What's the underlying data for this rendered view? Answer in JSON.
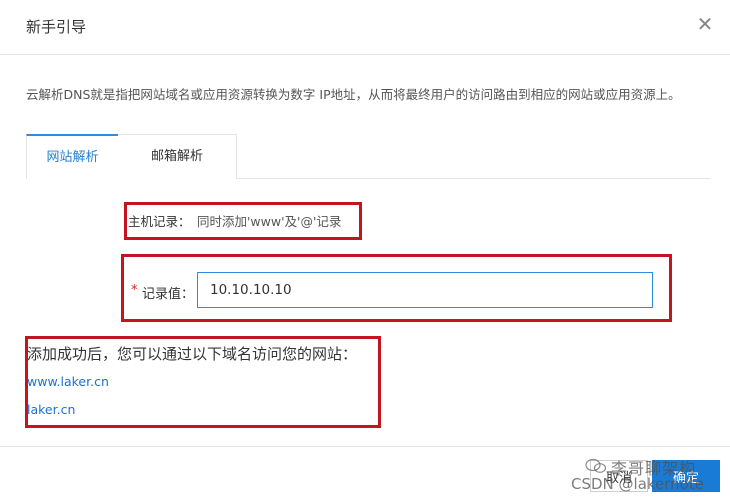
{
  "dialog": {
    "title": "新手引导",
    "close_glyph": "✕",
    "description": "云解析DNS就是指把网站域名或应用资源转换为数字 IP地址，从而将最终用户的访问路由到相应的网站或应用资源上。"
  },
  "tabs": [
    {
      "label": "网站解析",
      "active": true
    },
    {
      "label": "邮箱解析",
      "active": false
    }
  ],
  "form": {
    "host_record_label": "主机记录：",
    "host_record_value": "同时添加'www'及'@'记录",
    "required_mark": "*",
    "record_value_label": "记录值：",
    "record_value": "10.10.10.10"
  },
  "result": {
    "message": "添加成功后，您可以通过以下域名访问您的网站：",
    "domains": [
      "www.laker.cn",
      "laker.cn"
    ]
  },
  "footer": {
    "cancel_label": "取消",
    "ok_label": "确定"
  },
  "watermark": {
    "line1": "李哥聊架构",
    "line2": "CSDN @lakernote"
  },
  "colors": {
    "accent": "#1a7bd6",
    "highlight_box": "#c41420",
    "link": "#1f6fd0"
  }
}
